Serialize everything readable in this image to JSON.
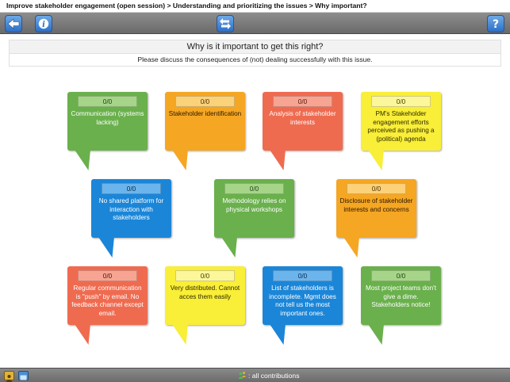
{
  "breadcrumb": "Improve stakeholder engagement (open session) > Understanding and prioritizing the issues > Why important?",
  "toolbar": {
    "back_icon": "back-arrow-icon",
    "info_icon": "info-icon",
    "swap_icon": "swap-arrows-icon",
    "help_icon": "help-icon"
  },
  "header": {
    "question": "Why is it important to get this right?",
    "instruction": "Please discuss the consequences of (not) dealing successfully with this issue."
  },
  "bubbles": [
    {
      "color": "#6ab04c",
      "score": "0/0",
      "text": "Communication (systems lacking)"
    },
    {
      "color": "#f5a623",
      "score": "0/0",
      "text": "Stakeholder identification"
    },
    {
      "color": "#ef6b50",
      "score": "0/0",
      "text": "Analysis of stakeholder interests"
    },
    {
      "color": "#f9ee38",
      "score": "0/0",
      "text": "PM's Stakeholder engagement efforts perceived as pushing a (political) agenda"
    },
    {
      "color": "#1b86d8",
      "score": "0/0",
      "text": "No shared platform for interaction with stakeholders"
    },
    {
      "color": "#6ab04c",
      "score": "0/0",
      "text": "Methodology relies on physical workshops"
    },
    {
      "color": "#f5a623",
      "score": "0/0",
      "text": "Disclosure of stakeholder interests and concerns"
    },
    {
      "color": "#ef6b50",
      "score": "0/0",
      "text": "Regular communication is \"push\" by email. No feedback channel except email."
    },
    {
      "color": "#f9ee38",
      "score": "0/0",
      "text": "Very distributed. Cannot acces them easily"
    },
    {
      "color": "#1b86d8",
      "score": "0/0",
      "text": "List of stakeholders is incomplete. Mgmt does not tell us the most important ones."
    },
    {
      "color": "#6ab04c",
      "score": "0/0",
      "text": "Most project teams don't give a dime. Stakeholders notice!"
    }
  ],
  "statusbar": {
    "contributions_label": ": all contributions",
    "people_icon": "people-icon",
    "screen_icon": "screen-icon",
    "contributors_icon": "contributors-icon"
  }
}
